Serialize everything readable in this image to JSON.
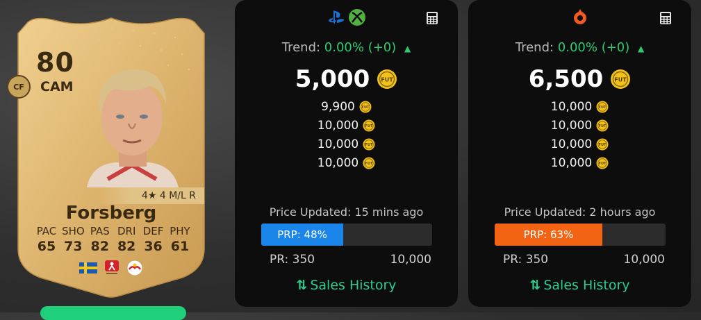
{
  "card": {
    "rating": "80",
    "position": "CAM",
    "alt_position": "CF",
    "skills_line": "4★ 4 M/L R",
    "name": "Forsberg",
    "stat_labels": [
      "PAC",
      "SHO",
      "PAS",
      "DRI",
      "DEF",
      "PHY"
    ],
    "stat_values": [
      "65",
      "73",
      "82",
      "82",
      "36",
      "61"
    ],
    "badges": [
      "sweden-flag-icon",
      "bundesliga-icon",
      "rb-leipzig-badge-icon"
    ]
  },
  "panels": [
    {
      "platform_icons": [
        "playstation-icon",
        "xbox-icon"
      ],
      "trend_label": "Trend:",
      "trend_value": "0.00% (+0)",
      "price": "5,000",
      "sub_prices": [
        "9,900",
        "10,000",
        "10,000",
        "10,000"
      ],
      "updated": "Price Updated: 15 mins ago",
      "prp_label": "PRP: 48%",
      "prp_fraction": 0.48,
      "prp_color": "#1a86ea",
      "pr_min": "PR: 350",
      "pr_max": "10,000",
      "sales_label": "Sales History"
    },
    {
      "platform_icons": [
        "origin-icon"
      ],
      "trend_label": "Trend:",
      "trend_value": "0.00% (+0)",
      "price": "6,500",
      "sub_prices": [
        "10,000",
        "10,000",
        "10,000",
        "10,000"
      ],
      "updated": "Price Updated: 2 hours ago",
      "prp_label": "PRP: 63%",
      "prp_fraction": 0.63,
      "prp_color": "#f26414",
      "pr_min": "PR: 350",
      "pr_max": "10,000",
      "sales_label": "Sales History"
    }
  ],
  "coin_text": "FUT",
  "colors": {
    "trend_green": "#2ecc71",
    "sales_green": "#2ecc8f",
    "coin_gold": "#f2c21b",
    "card_gold": "#d8ae66"
  }
}
